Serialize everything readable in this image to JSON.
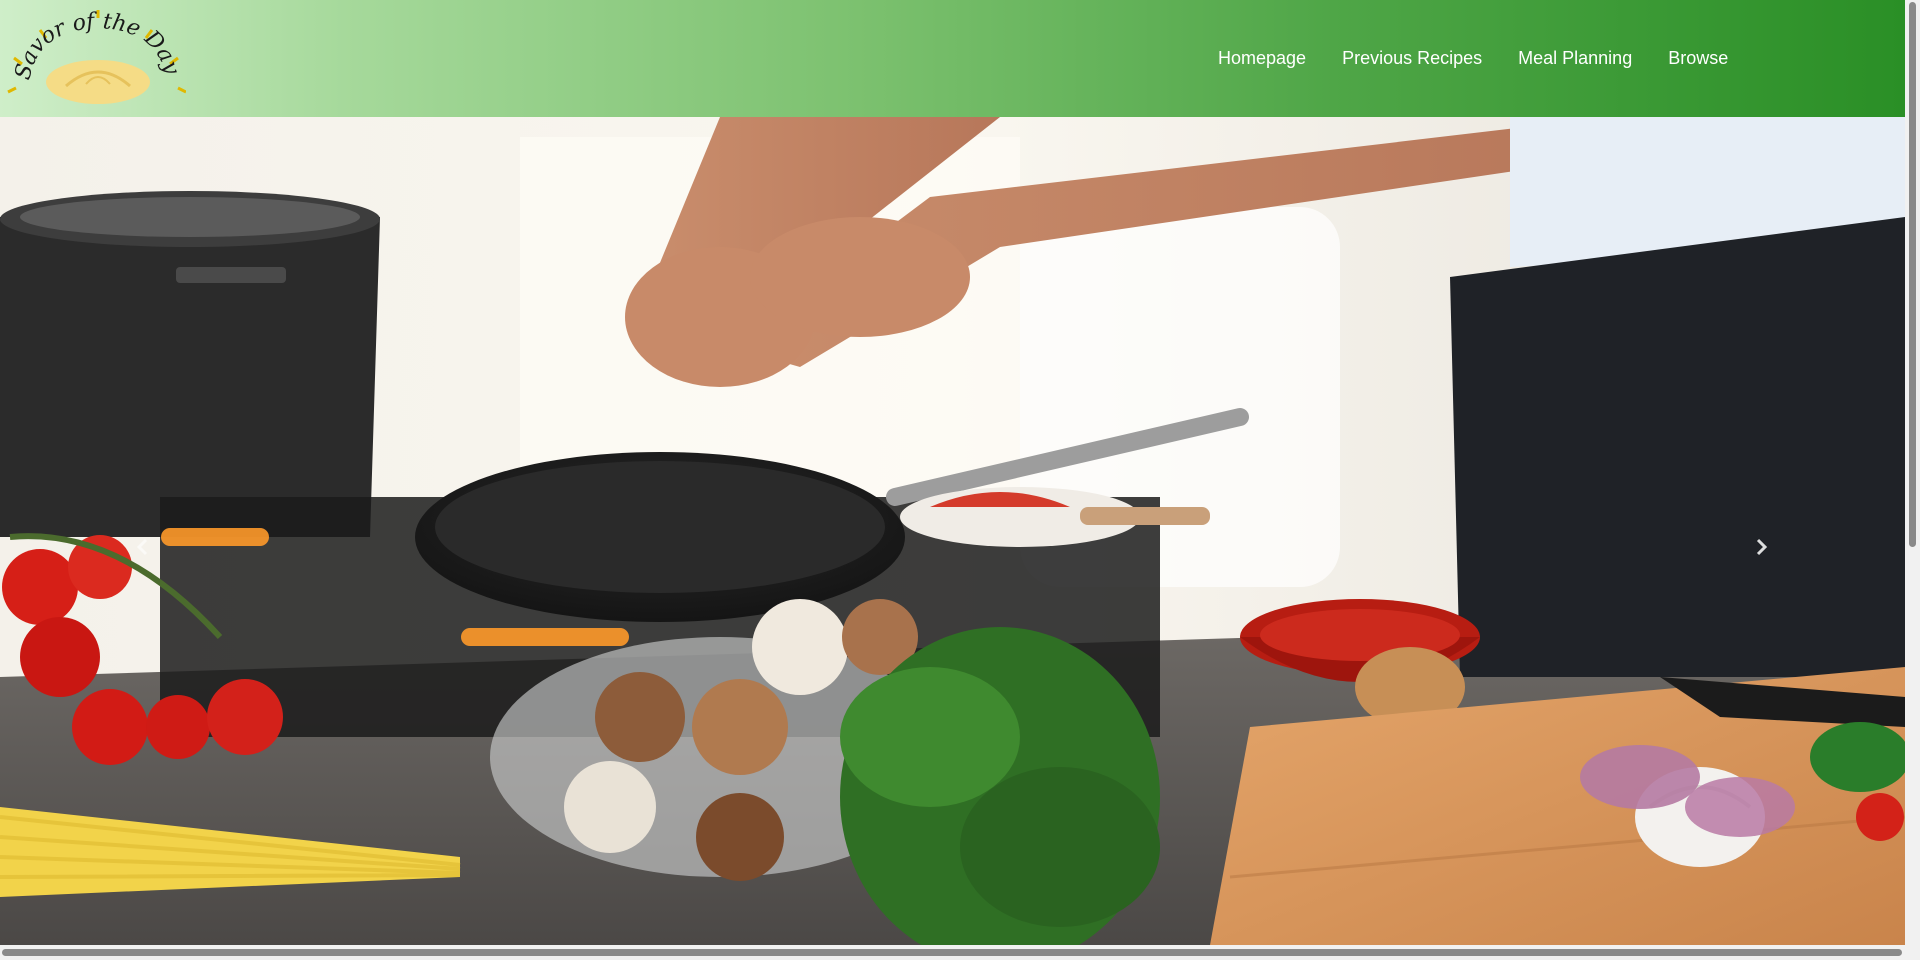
{
  "header": {
    "logo_text": "Savor of the Day",
    "nav": [
      {
        "label": "Homepage"
      },
      {
        "label": "Previous Recipes"
      },
      {
        "label": "Meal Planning"
      },
      {
        "label": "Browse"
      }
    ]
  },
  "hero": {
    "image_icon": "cooking-scene-photo",
    "prev_icon": "chevron-left-icon",
    "next_icon": "chevron-right-icon"
  },
  "colors": {
    "header_start": "#cfeec9",
    "header_end": "#2a8f26",
    "nav_text": "#ffffff"
  }
}
